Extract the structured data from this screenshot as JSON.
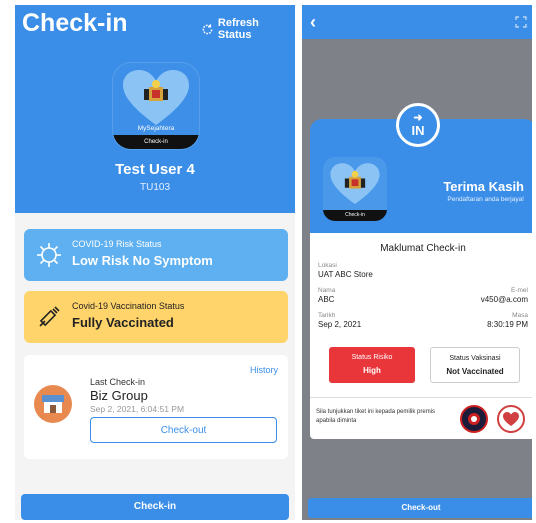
{
  "left": {
    "title": "Check-in",
    "refresh_label": "Refresh Status",
    "app_icon": {
      "brand": "MySejahtera",
      "bar": "Check-in"
    },
    "user_name": "Test User 4",
    "user_id": "TU103",
    "risk": {
      "label": "COVID-19 Risk Status",
      "value": "Low Risk No Symptom"
    },
    "vaccination": {
      "label": "Covid-19 Vaccination Status",
      "value": "Fully Vaccinated"
    },
    "last_checkin": {
      "history_link": "History",
      "label": "Last Check-in",
      "place": "Biz Group",
      "date": "Sep 2, 2021, 6:04:51 PM",
      "checkout_label": "Check-out"
    },
    "bottom_button": "Check-in"
  },
  "right": {
    "in_badge": {
      "arrow": "➜",
      "text": "IN"
    },
    "app_icon": {
      "bar": "Check-in"
    },
    "thanks_title": "Terima Kasih",
    "thanks_sub": "Pendaftaran anda berjaya!",
    "section_title": "Maklumat Check-in",
    "fields": {
      "lokasi_label": "Lokasi",
      "lokasi_value": "UAT ABC Store",
      "nama_label": "Nama",
      "nama_value": "ABC",
      "email_label": "E-mel",
      "email_value": "v450@a.com",
      "tarikh_label": "Tarikh",
      "tarikh_value": "Sep 2, 2021",
      "masa_label": "Masa",
      "masa_value": "8:30:19 PM"
    },
    "risk_pill": {
      "label": "Status Risiko",
      "value": "High"
    },
    "vacc_pill": {
      "label": "Status Vaksinasi",
      "value": "Not Vaccinated"
    },
    "notice": "Sila tunjukkan tiket ini kepada pemilik premis apabila diminta",
    "bottom_button": "Check-out"
  },
  "colors": {
    "primary_blue": "#3a8ee8",
    "risk_blue": "#5eb0f0",
    "vacc_yellow": "#ffd46b",
    "high_red": "#e8363a"
  }
}
